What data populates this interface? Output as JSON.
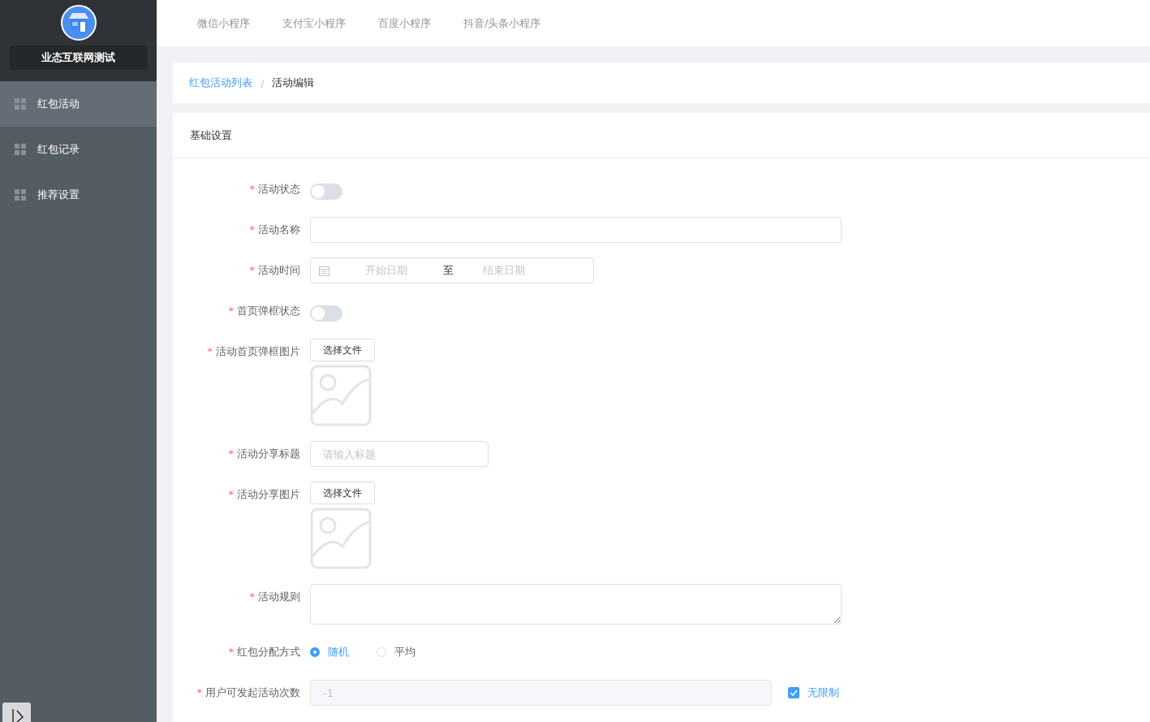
{
  "sidebar": {
    "title": "业态互联网测试",
    "items": [
      {
        "label": "红包活动",
        "selected": true
      },
      {
        "label": "红包记录",
        "selected": false
      },
      {
        "label": "推荐设置",
        "selected": false
      }
    ]
  },
  "top_tabs": [
    {
      "label": "微信小程序"
    },
    {
      "label": "支付宝小程序"
    },
    {
      "label": "百度小程序"
    },
    {
      "label": "抖音/头条小程序"
    }
  ],
  "breadcrumb": {
    "separator": "/",
    "items": [
      {
        "label": "红包活动列表",
        "kind": "link"
      },
      {
        "label": "活动编辑",
        "kind": "current"
      }
    ]
  },
  "section_title": "基础设置",
  "form": [
    {
      "kind": "switch",
      "label": "活动状态",
      "required_mark": "*",
      "on": false
    },
    {
      "kind": "long-text",
      "label": "活动名称",
      "required_mark": "*"
    },
    {
      "kind": "daterange",
      "label": "活动时间",
      "required_mark": "*",
      "start_placeholder": "开始日期",
      "separator": "至",
      "end_placeholder": "结束日期"
    },
    {
      "kind": "switch",
      "label": "首页弹框状态",
      "required_mark": "*",
      "on": false
    },
    {
      "kind": "upload",
      "label": "活动首页弹框图片",
      "required_mark": "*",
      "button": "选择文件"
    },
    {
      "kind": "short-text",
      "label": "活动分享标题",
      "required_mark": "*",
      "placeholder": "请输入标题"
    },
    {
      "kind": "upload",
      "label": "活动分享图片",
      "required_mark": "*",
      "button": "选择文件"
    },
    {
      "kind": "textarea",
      "label": "活动规则",
      "required_mark": "*"
    },
    {
      "kind": "radio",
      "label": "红包分配方式",
      "required_mark": "*",
      "options": [
        {
          "label": "随机",
          "selected": true
        },
        {
          "label": "平均",
          "selected": false
        }
      ]
    },
    {
      "kind": "limit",
      "label": "用户可发起活动次数",
      "required_mark": "*",
      "value": "-1",
      "disabled": true,
      "checkbox": {
        "label": "无限制",
        "checked": true
      }
    }
  ]
}
